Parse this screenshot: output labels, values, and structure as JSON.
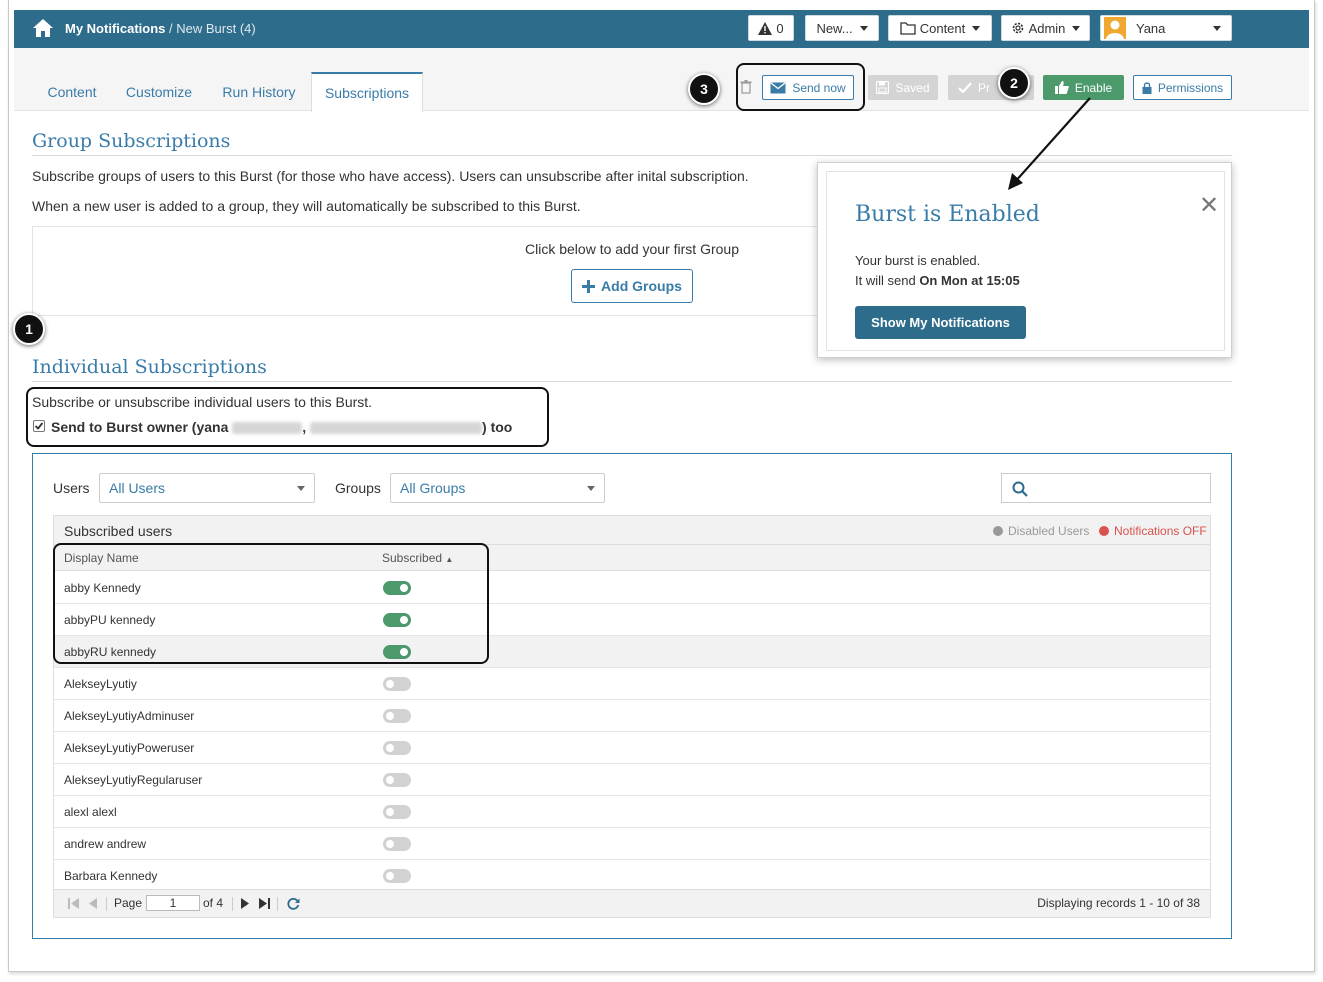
{
  "header": {
    "breadcrumb_root": "My Notifications",
    "breadcrumb_sep": " / ",
    "breadcrumb_current": "New Burst (4)",
    "alerts_count": "0",
    "new_label": "New...",
    "content_label": "Content",
    "admin_label": "Admin",
    "user_name": "Yana"
  },
  "tabs": [
    "Content",
    "Customize",
    "Run History",
    "Subscriptions"
  ],
  "active_tab": "Subscriptions",
  "actions": {
    "send_now": "Send now",
    "saved": "Saved",
    "publish_partial": "Pr",
    "enable": "Enable",
    "permissions": "Permissions"
  },
  "callouts": [
    "1",
    "2",
    "3"
  ],
  "group_subscriptions": {
    "title": "Group Subscriptions",
    "desc1": "Subscribe groups of users to this Burst (for those who have access). Users can unsubscribe after inital subscription.",
    "desc2": "When a new user is added to a group, they will automatically be subscribed to this Burst.",
    "empty_text": "Click below to add your first Group",
    "add_groups": "Add Groups"
  },
  "popover": {
    "title": "Burst is Enabled",
    "line1": "Your burst is enabled.",
    "line2_prefix": "It will send ",
    "line2_bold": "On Mon at 15:05",
    "button": "Show My Notifications"
  },
  "individual_subscriptions": {
    "title": "Individual Subscriptions",
    "desc": "Subscribe or unsubscribe individual users to this Burst.",
    "owner_prefix": "Send to Burst owner (yana ",
    "owner_suffix": ") too",
    "owner_checked": true
  },
  "filters": {
    "users_label": "Users",
    "users_value": "All Users",
    "groups_label": "Groups",
    "groups_value": "All Groups"
  },
  "grid": {
    "title": "Subscribed users",
    "legend_disabled": "Disabled Users",
    "legend_notif_off": "Notifications OFF",
    "col_name": "Display Name",
    "col_subscribed": "Subscribed",
    "rows": [
      {
        "name": "abby Kennedy",
        "subscribed": true
      },
      {
        "name": "abbyPU kennedy",
        "subscribed": true
      },
      {
        "name": "abbyRU kennedy",
        "subscribed": true
      },
      {
        "name": "AlekseyLyutiy",
        "subscribed": false
      },
      {
        "name": "AlekseyLyutiyAdminuser",
        "subscribed": false
      },
      {
        "name": "AlekseyLyutiyPoweruser",
        "subscribed": false
      },
      {
        "name": "AlekseyLyutiyRegularuser",
        "subscribed": false
      },
      {
        "name": "alexl alexl",
        "subscribed": false
      },
      {
        "name": "andrew andrew",
        "subscribed": false
      },
      {
        "name": "Barbara Kennedy",
        "subscribed": false
      }
    ],
    "pager": {
      "page_label": "Page",
      "page_value": "1",
      "of_label": "of 4",
      "display_text": "Displaying records 1 - 10 of 38"
    }
  },
  "colors": {
    "brand": "#2e6c8c",
    "link": "#3a7ca8",
    "enable_green": "#4c9a6b",
    "legend_disabled": "#999999",
    "legend_notif_off": "#d9534f"
  }
}
